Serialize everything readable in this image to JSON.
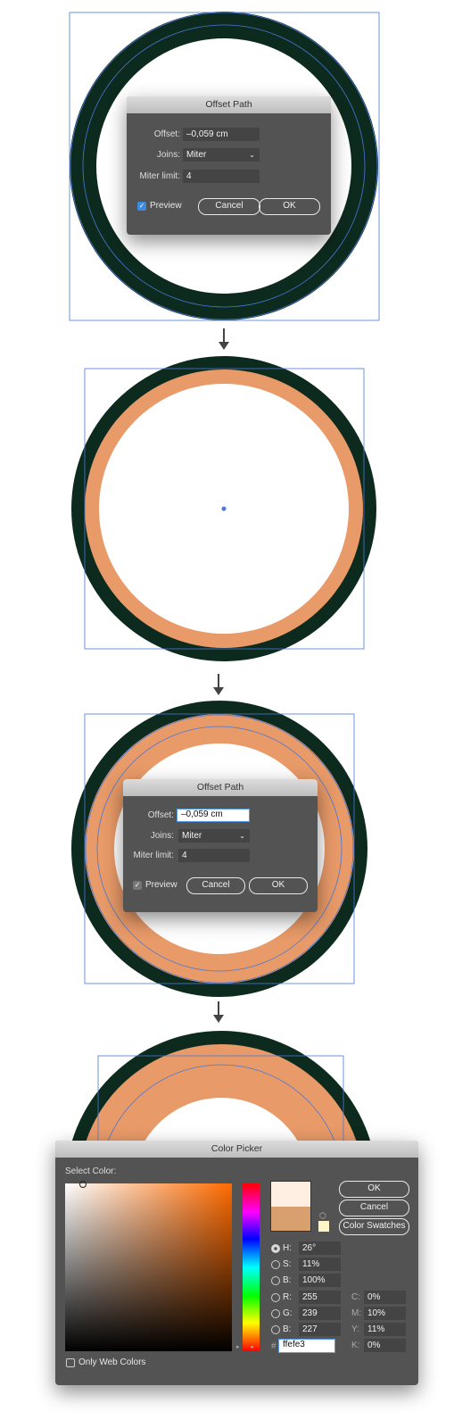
{
  "colors": {
    "dark_ring": "#0d2a1e",
    "orange": "#e89a68",
    "selection": "#4a78d8",
    "dialog_bg": "#535353"
  },
  "offset_dialog_1": {
    "title": "Offset Path",
    "offset_label": "Offset:",
    "offset_value": "–0,059 cm",
    "joins_label": "Joins:",
    "joins_value": "Miter",
    "miter_label": "Miter limit:",
    "miter_value": "4",
    "preview_label": "Preview",
    "preview_checked": true,
    "cancel": "Cancel",
    "ok": "OK"
  },
  "offset_dialog_2": {
    "title": "Offset Path",
    "offset_label": "Offset:",
    "offset_value": "–0,059 cm",
    "joins_label": "Joins:",
    "joins_value": "Miter",
    "miter_label": "Miter limit:",
    "miter_value": "4",
    "preview_label": "Preview",
    "preview_checked": true,
    "cancel": "Cancel",
    "ok": "OK"
  },
  "color_picker": {
    "title": "Color Picker",
    "select_label": "Select Color:",
    "ok": "OK",
    "cancel": "Cancel",
    "swatches": "Color Swatches",
    "new_color": "#ffefe3",
    "old_color": "#d9a06f",
    "fields": [
      {
        "label": "H:",
        "value": "26°",
        "selected": true
      },
      {
        "label": "S:",
        "value": "11%"
      },
      {
        "label": "B:",
        "value": "100%"
      },
      {
        "label": "R:",
        "value": "255"
      },
      {
        "label": "G:",
        "value": "239"
      },
      {
        "label": "B:",
        "value": "227"
      }
    ],
    "cmyk": [
      {
        "label": "C:",
        "value": "0%"
      },
      {
        "label": "M:",
        "value": "10%"
      },
      {
        "label": "Y:",
        "value": "11%"
      },
      {
        "label": "K:",
        "value": "0%"
      }
    ],
    "hex_label": "#",
    "hex_value": "ffefe3",
    "web_colors_label": "Only Web Colors",
    "web_colors_checked": false
  }
}
